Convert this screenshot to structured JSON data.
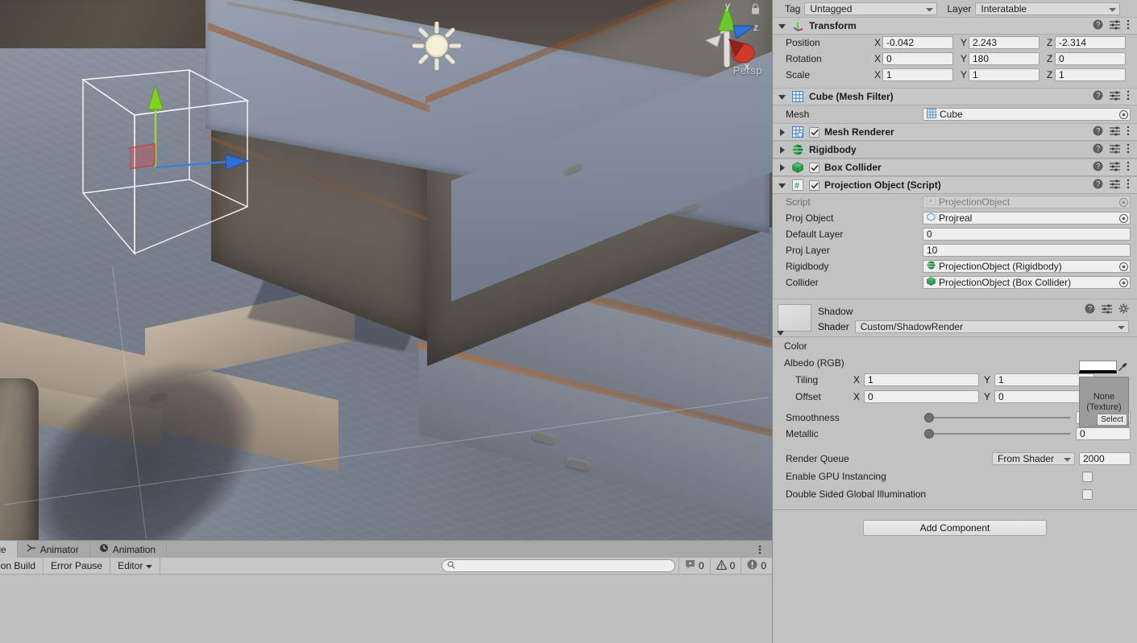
{
  "scene": {
    "view_label": "Persp",
    "gizmo_axes": [
      "y",
      "z",
      "x"
    ],
    "light_gizmo": "directional-light-icon",
    "lock_icon": "lock-icon"
  },
  "inspector": {
    "tag": {
      "label": "Tag",
      "value": "Untagged"
    },
    "layer": {
      "label": "Layer",
      "value": "Interatable"
    },
    "transform": {
      "title": "Transform",
      "rows": [
        {
          "label": "Position",
          "x": "-0.042",
          "y": "2.243",
          "z": "-2.314"
        },
        {
          "label": "Rotation",
          "x": "0",
          "y": "180",
          "z": "0"
        },
        {
          "label": "Scale",
          "x": "1",
          "y": "1",
          "z": "1"
        }
      ],
      "axis_x": "X",
      "axis_y": "Y",
      "axis_z": "Z"
    },
    "mesh_filter": {
      "title": "Cube (Mesh Filter)",
      "mesh_label": "Mesh",
      "mesh_value": "Cube"
    },
    "components": [
      {
        "title": "Mesh Renderer",
        "icon": "mesh-renderer-icon",
        "has_checkbox": true,
        "checked": true
      },
      {
        "title": "Rigidbody",
        "icon": "rigidbody-icon",
        "has_checkbox": false,
        "checked": false
      },
      {
        "title": "Box Collider",
        "icon": "box-collider-icon",
        "has_checkbox": true,
        "checked": true
      }
    ],
    "projection_object": {
      "title": "Projection Object (Script)",
      "icon": "script-icon",
      "checked": true,
      "fields": [
        {
          "label": "Script",
          "value": "ProjectionObject",
          "type": "object",
          "disabled": true,
          "icon": "script-icon"
        },
        {
          "label": "Proj Object",
          "value": "Projreal",
          "type": "object",
          "disabled": false,
          "icon": "prefab-icon"
        },
        {
          "label": "Default Layer",
          "value": "0",
          "type": "text",
          "disabled": false,
          "icon": ""
        },
        {
          "label": "Proj Layer",
          "value": "10",
          "type": "text",
          "disabled": false,
          "icon": ""
        },
        {
          "label": "Rigidbody",
          "value": "ProjectionObject (Rigidbody)",
          "type": "object",
          "disabled": false,
          "icon": "rigidbody-icon"
        },
        {
          "label": "Collider",
          "value": "ProjectionObject (Box Collider)",
          "type": "object",
          "disabled": false,
          "icon": "box-collider-icon"
        }
      ]
    },
    "material": {
      "name": "Shadow",
      "shader_label": "Shader",
      "shader_value": "Custom/ShadowRender",
      "color_label": "Color",
      "color_value": "#FFFFFF",
      "albedo_label": "Albedo (RGB)",
      "texture_none_line1": "None",
      "texture_none_line2": "(Texture)",
      "texture_select": "Select",
      "tiling_label": "Tiling",
      "tiling_x": "1",
      "tiling_y": "1",
      "offset_label": "Offset",
      "offset_x": "0",
      "offset_y": "0",
      "axis_x": "X",
      "axis_y": "Y",
      "smoothness_label": "Smoothness",
      "smoothness_value": "0",
      "metallic_label": "Metallic",
      "metallic_value": "0",
      "render_queue_label": "Render Queue",
      "render_queue_mode": "From Shader",
      "render_queue_value": "2000",
      "gpu_instancing_label": "Enable GPU Instancing",
      "gpu_instancing_checked": false,
      "double_sided_label": "Double Sided Global Illumination",
      "double_sided_checked": false
    },
    "add_component": "Add Component"
  },
  "bottom_panel": {
    "tabs": [
      {
        "label": "nsole",
        "icon": "console-icon",
        "active": true
      },
      {
        "label": "Animator",
        "icon": "animator-icon",
        "active": false
      },
      {
        "label": "Animation",
        "icon": "animation-icon",
        "active": false
      }
    ],
    "toolbar": [
      {
        "label": "ear on Build",
        "type": "button"
      },
      {
        "label": "Error Pause",
        "type": "button"
      },
      {
        "label": "Editor",
        "type": "dropdown"
      }
    ],
    "search_placeholder": "",
    "search_value": "",
    "counts": [
      {
        "icon": "log-icon",
        "value": "0"
      },
      {
        "icon": "warning-icon",
        "value": "0"
      },
      {
        "icon": "error-icon",
        "value": "0"
      }
    ]
  },
  "colors": {
    "panel_bg": "#c2c2c2",
    "header_bg": "#c7c7c7",
    "field_bg": "#efefef",
    "axis_x": "#d93a3a",
    "axis_y": "#6fd13a",
    "axis_z": "#3a7ad9"
  }
}
